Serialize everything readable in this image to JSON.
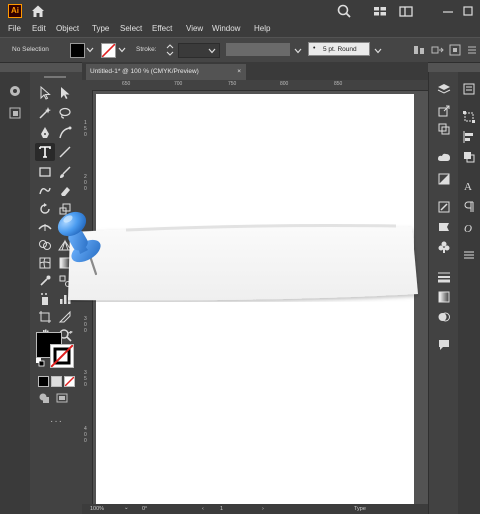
{
  "app": {
    "logo_text": "Ai",
    "brand_color": "#ff9a00"
  },
  "menu": {
    "items": [
      "File",
      "Edit",
      "Object",
      "Type",
      "Select",
      "Effect",
      "View",
      "Window",
      "Help"
    ]
  },
  "controlbar": {
    "selection_label": "No Selection",
    "stroke_label": "Stroke:",
    "brush_label": "5 pt. Round"
  },
  "document": {
    "tab_title": "Untitled-1* @ 100 % (CMYK/Preview)",
    "close_glyph": "×"
  },
  "ruler": {
    "h_ticks": [
      "650",
      "700",
      "750",
      "800",
      "850"
    ],
    "v_ticks": [
      "1",
      "5",
      "0",
      "2",
      "0",
      "0",
      "2",
      "5",
      "0",
      "3",
      "0",
      "0",
      "3",
      "5",
      "0",
      "4",
      "0",
      "0"
    ]
  },
  "status": {
    "zoom": "100%",
    "rotation": "0°",
    "artboard": "1",
    "tool": "Type"
  },
  "colors": {
    "fill": "#000000",
    "stroke": "none",
    "pin": "#3d8fe0"
  }
}
